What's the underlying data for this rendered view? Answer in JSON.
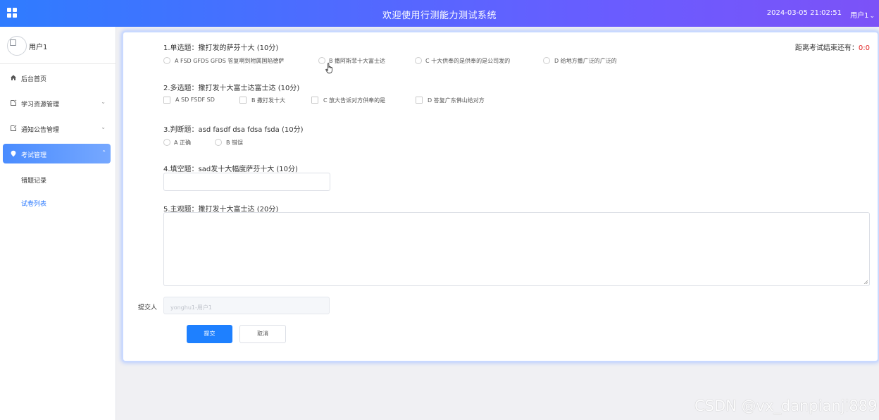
{
  "header": {
    "title": "欢迎使用行测能力测试系统",
    "datetime": "2024-03-05 21:02:51",
    "user_menu": "用户1",
    "user_menu_chevron": "⌄"
  },
  "sidebar": {
    "user_name": "用户1",
    "menu": [
      {
        "label": "后台首页",
        "icon": "home-icon"
      },
      {
        "label": "学习资源管理",
        "icon": "document-icon",
        "expandable": true
      },
      {
        "label": "通知公告管理",
        "icon": "document-icon",
        "expandable": true
      },
      {
        "label": "考试管理",
        "icon": "location-pin-icon",
        "expandable": true,
        "active": true
      }
    ],
    "submenu": [
      {
        "label": "错题记录"
      },
      {
        "label": "试卷列表",
        "selected": true
      }
    ],
    "chevron_down": "⌄",
    "chevron_up": "⌃"
  },
  "exam": {
    "timer_label": "距离考试结束还有：",
    "timer_value": "0:0",
    "questions": [
      {
        "title": "1.单选题：撒打发的萨芬十大 (10分)",
        "type": "radio",
        "options": [
          "A FSD GFDS GFDS 答复啊到附属国陷德萨",
          "B 撒阿斯菲十大富士达",
          "C 十大供奉的是供奉的是公司发的",
          "D 给地方撒广泛的广泛的"
        ]
      },
      {
        "title": "2.多选题：撒打发十大富士达富士达 (10分)",
        "type": "checkbox",
        "options": [
          "A SD FSDF SD",
          "B 撒打发十大",
          "C 放大告诉对方供奉的是",
          "D 答复广东佛山给对方"
        ]
      },
      {
        "title": "3.判断题：asd fasdf dsa fdsa fsda (10分)",
        "type": "radio",
        "options": [
          "A 正确",
          "B 错误"
        ]
      },
      {
        "title": "4.填空题：sad发十大幅度萨芬十大 (10分)",
        "type": "text",
        "value": ""
      },
      {
        "title": "5.主观题：撒打发十大富士达 (20分)",
        "type": "textarea",
        "value": ""
      }
    ],
    "submitter_label": "提交人",
    "submitter_value": "yonghu1-用户1",
    "submit_label": "提交",
    "cancel_label": "取消"
  },
  "watermark": "CSDN @vx_danpianji889",
  "colors": {
    "header_start": "#2f7cff",
    "header_end": "#7c52f7",
    "primary": "#1e80ff",
    "timer_value": "#e02020",
    "active_menu": "#4a8cff"
  }
}
